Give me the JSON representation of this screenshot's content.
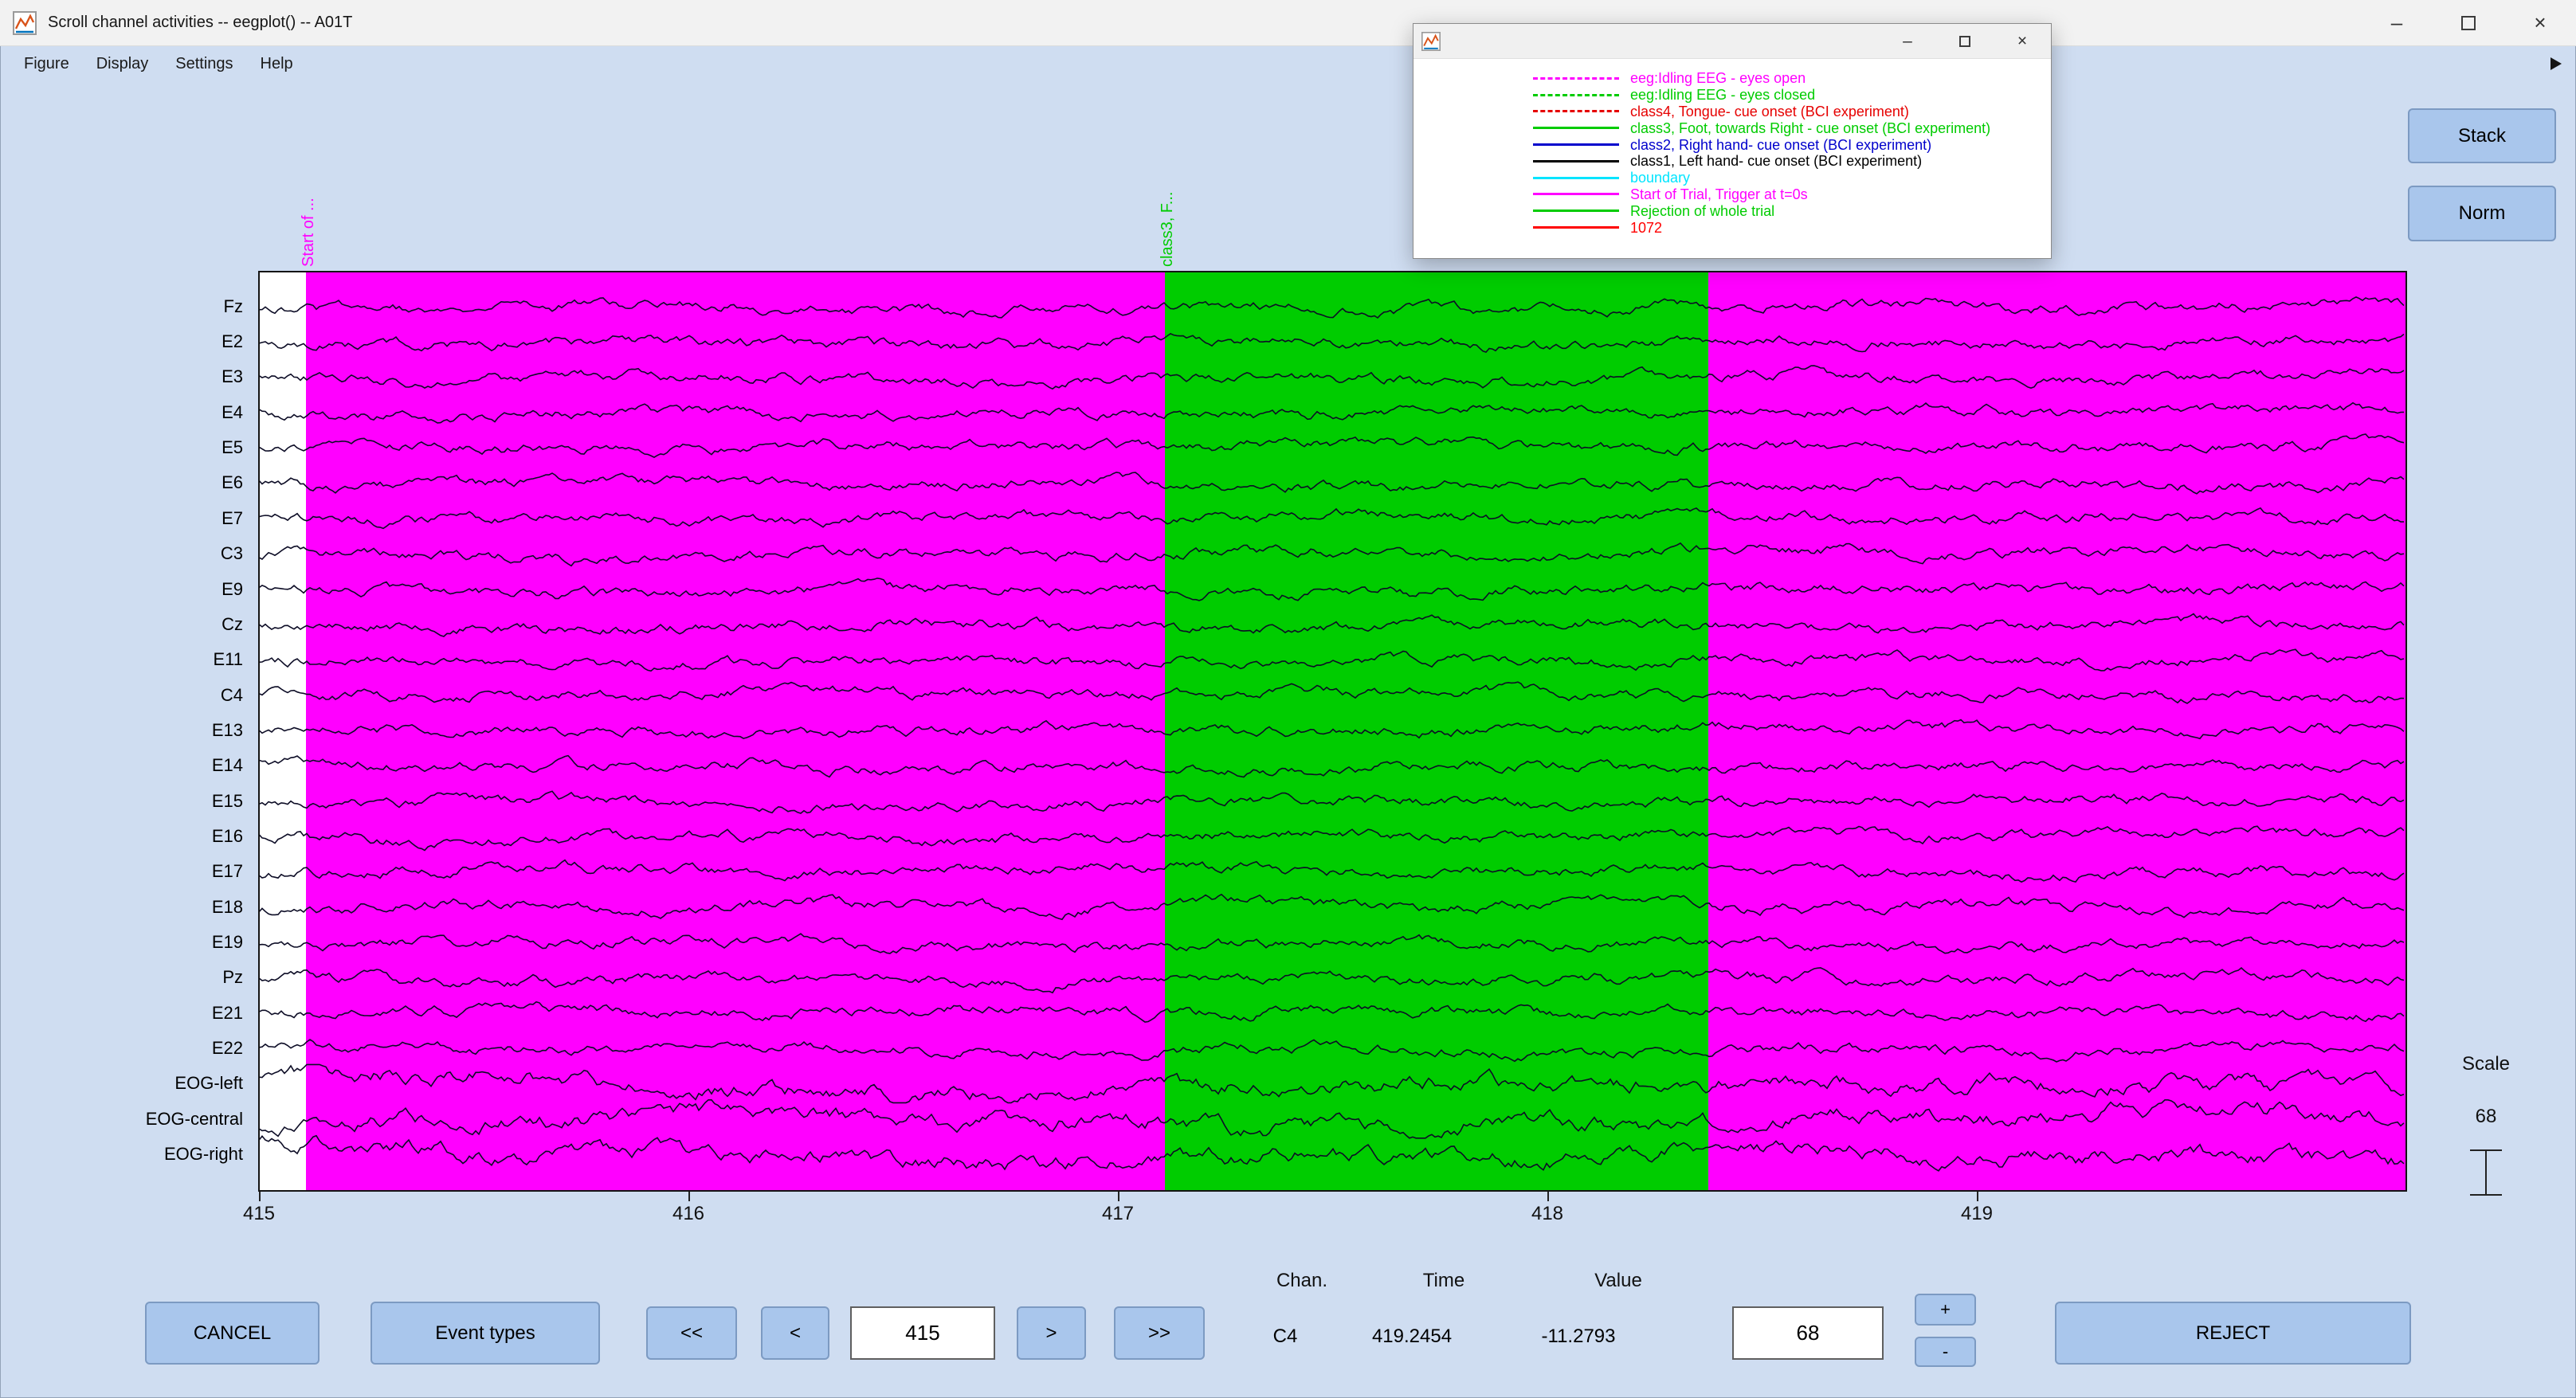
{
  "window": {
    "title": "Scroll channel activities -- eegplot() -- A01T",
    "menu": [
      "Figure",
      "Display",
      "Settings",
      "Help"
    ]
  },
  "icons": {
    "minimize": "–",
    "close": "×"
  },
  "legend_window": {
    "items": [
      {
        "label": "eeg:Idling EEG - eyes open",
        "color": "#ff00ff",
        "dashed": true
      },
      {
        "label": "eeg:Idling EEG - eyes closed",
        "color": "#00cc00",
        "dashed": true
      },
      {
        "label": "class4, Tongue- cue onset (BCI experiment)",
        "color": "#e60000",
        "dashed": true
      },
      {
        "label": "class3, Foot, towards Right - cue onset (BCI experiment)",
        "color": "#00cc00",
        "dashed": false
      },
      {
        "label": "class2, Right hand- cue onset (BCI experiment)",
        "color": "#0000cc",
        "dashed": false
      },
      {
        "label": "class1, Left hand- cue onset (BCI experiment)",
        "color": "#000000",
        "dashed": false
      },
      {
        "label": "boundary",
        "color": "#00e5ff",
        "dashed": false
      },
      {
        "label": "Start of Trial, Trigger at t=0s",
        "color": "#ff00ff",
        "dashed": false
      },
      {
        "label": "Rejection of whole trial",
        "color": "#00cc00",
        "dashed": false
      },
      {
        "label": "1072",
        "color": "#ff0000",
        "dashed": false
      }
    ]
  },
  "side_buttons": {
    "stack": "Stack",
    "norm": "Norm"
  },
  "plot": {
    "channels": [
      "Fz",
      "E2",
      "E3",
      "E4",
      "E5",
      "E6",
      "E7",
      "C3",
      "E9",
      "Cz",
      "E11",
      "C4",
      "E13",
      "E14",
      "E15",
      "E16",
      "E17",
      "E18",
      "E19",
      "Pz",
      "E21",
      "E22",
      "EOG-left",
      "EOG-central",
      "EOG-right"
    ],
    "x_ticks": [
      "415",
      "416",
      "417",
      "418",
      "419"
    ],
    "x_start": 415,
    "x_end": 420,
    "regions": [
      {
        "from": 415.0,
        "to": 415.112,
        "color": "#ffffff"
      },
      {
        "from": 415.112,
        "to": 417.112,
        "color": "#ff00ff"
      },
      {
        "from": 417.112,
        "to": 418.378,
        "color": "#00cc00"
      },
      {
        "from": 418.378,
        "to": 420.0,
        "color": "#ff00ff"
      }
    ],
    "events": [
      {
        "x": 415.112,
        "color": "#ff00ff",
        "label": "Start of ..."
      },
      {
        "x": 417.112,
        "color": "#00cc00",
        "label": "class3, F..."
      },
      {
        "x": 418.378,
        "color": "#ff00ff",
        "label": ""
      }
    ]
  },
  "scale": {
    "label": "Scale",
    "value": "68"
  },
  "status": {
    "chan_label": "Chan.",
    "time_label": "Time",
    "value_label": "Value",
    "chan": "C4",
    "time": "419.2454",
    "value": "-11.2793"
  },
  "controls": {
    "cancel": "CANCEL",
    "event_types": "Event types",
    "prev_page": "<<",
    "prev": "<",
    "next": ">",
    "next_page": ">>",
    "plus": "+",
    "minus": "-",
    "reject": "REJECT"
  },
  "inputs": {
    "position": "415",
    "scale": "68"
  },
  "colors": {
    "app_background": "#cfddf1",
    "button": "#a9c6ec",
    "magenta_region": "#ff00ff",
    "green_region": "#00cc00",
    "trace": "#0d0d26"
  }
}
